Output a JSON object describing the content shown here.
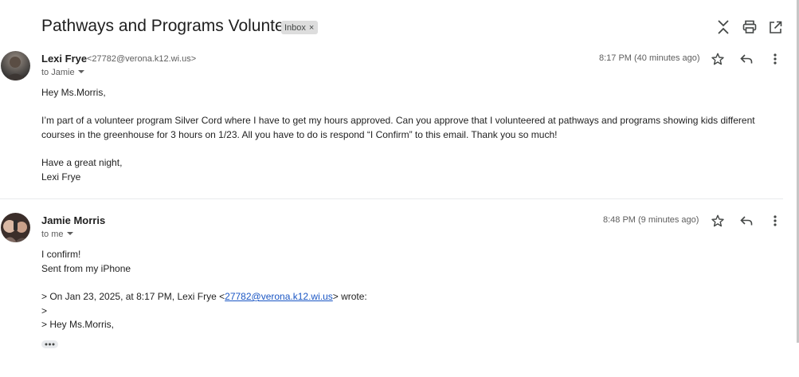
{
  "thread": {
    "subject": "Pathways and Programs Volunteer",
    "label": "Inbox",
    "label_close": "×"
  },
  "top_actions": {
    "collapse_icon": "collapse-all-icon",
    "print_icon": "print-icon",
    "open_icon": "open-in-new-window-icon"
  },
  "messages": [
    {
      "sender_name": "Lexi Frye",
      "sender_email": "<27782@verona.k12.wi.us>",
      "to": "to Jamie",
      "time": "8:17 PM (40 minutes ago)",
      "body": {
        "greeting": "Hey Ms.Morris,",
        "paragraph": "I’m part of a volunteer program Silver Cord where I have to get my hours approved. Can you approve that I volunteered at pathways and programs showing kids different courses in the greenhouse for 3 hours on 1/23. All you have to do is respond “I Confirm” to this email. Thank you so much!",
        "closing": "Have a great night,",
        "signature": "Lexi Frye"
      }
    },
    {
      "sender_name": "Jamie Morris",
      "to": "to me",
      "time": "8:48 PM (9 minutes ago)",
      "body": {
        "line1": "I confirm!",
        "line2": "Sent from my iPhone",
        "quote_prefix": "> On Jan 23, 2025, at 8:17 PM, Lexi Frye <",
        "quote_link": "27782@verona.k12.wi.us",
        "quote_suffix": "> wrote:",
        "quote_line2": ">",
        "quote_line3": "> Hey Ms.Morris,"
      }
    }
  ],
  "colors": {
    "accent_link": "#1a56c4",
    "label_bg": "#dddddd"
  }
}
